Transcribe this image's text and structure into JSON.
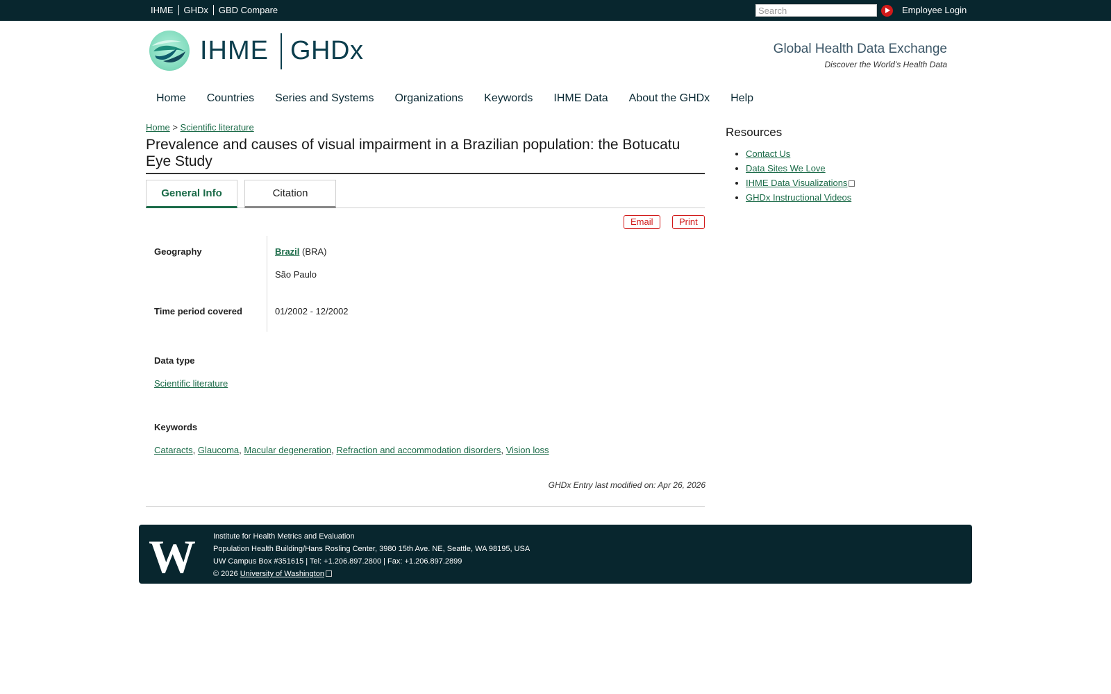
{
  "topbar": {
    "links": [
      "IHME",
      "GHDx",
      "GBD Compare"
    ],
    "search_placeholder": "Search",
    "login_label": "Employee Login"
  },
  "header": {
    "logo_ihme": "IHME",
    "logo_ghdx": "GHDx",
    "tagline": "Global Health Data Exchange",
    "subtagline": "Discover the World’s Health Data"
  },
  "nav": [
    "Home",
    "Countries",
    "Series and Systems",
    "Organizations",
    "Keywords",
    "IHME Data",
    "About the GHDx",
    "Help"
  ],
  "breadcrumb": {
    "home": "Home",
    "sep": ">",
    "current": "Scientific literature"
  },
  "page_title": "Prevalence and causes of visual impairment in a Brazilian population: the Botucatu Eye Study",
  "tabs": [
    "General Info",
    "Citation"
  ],
  "actions": {
    "email": "Email",
    "print": "Print"
  },
  "info": {
    "geography_label": "Geography",
    "country": "Brazil",
    "country_code": "(BRA)",
    "region": "São Paulo",
    "time_label": "Time period covered",
    "time_value": "01/2002 - 12/2002",
    "datatype_label": "Data type",
    "datatype_value": "Scientific literature",
    "keywords_label": "Keywords",
    "keywords": [
      "Cataracts",
      "Glaucoma",
      "Macular degeneration",
      "Refraction and accommodation disorders",
      "Vision loss"
    ],
    "modified": "GHDx Entry last modified on: Apr 26, 2026"
  },
  "sidebar": {
    "title": "Resources",
    "links": [
      "Contact Us",
      "Data Sites We Love",
      "IHME Data Visualizations",
      "GHDx Instructional Videos"
    ]
  },
  "footer": {
    "line1": "Institute for Health Metrics and Evaluation",
    "line2": "Population Health Building/Hans Rosling Center, 3980 15th Ave. NE, Seattle, WA 98195, USA",
    "line3": "UW Campus Box #351615 | Tel: +1.206.897.2800 | Fax: +1.206.897.2899",
    "copyright": "© 2026",
    "uw_link": "University of Washington",
    "uw_logo": "W"
  },
  "colors": {
    "topbar": "#08262e",
    "link": "#1b6b48",
    "accent": "#d11a1a"
  }
}
